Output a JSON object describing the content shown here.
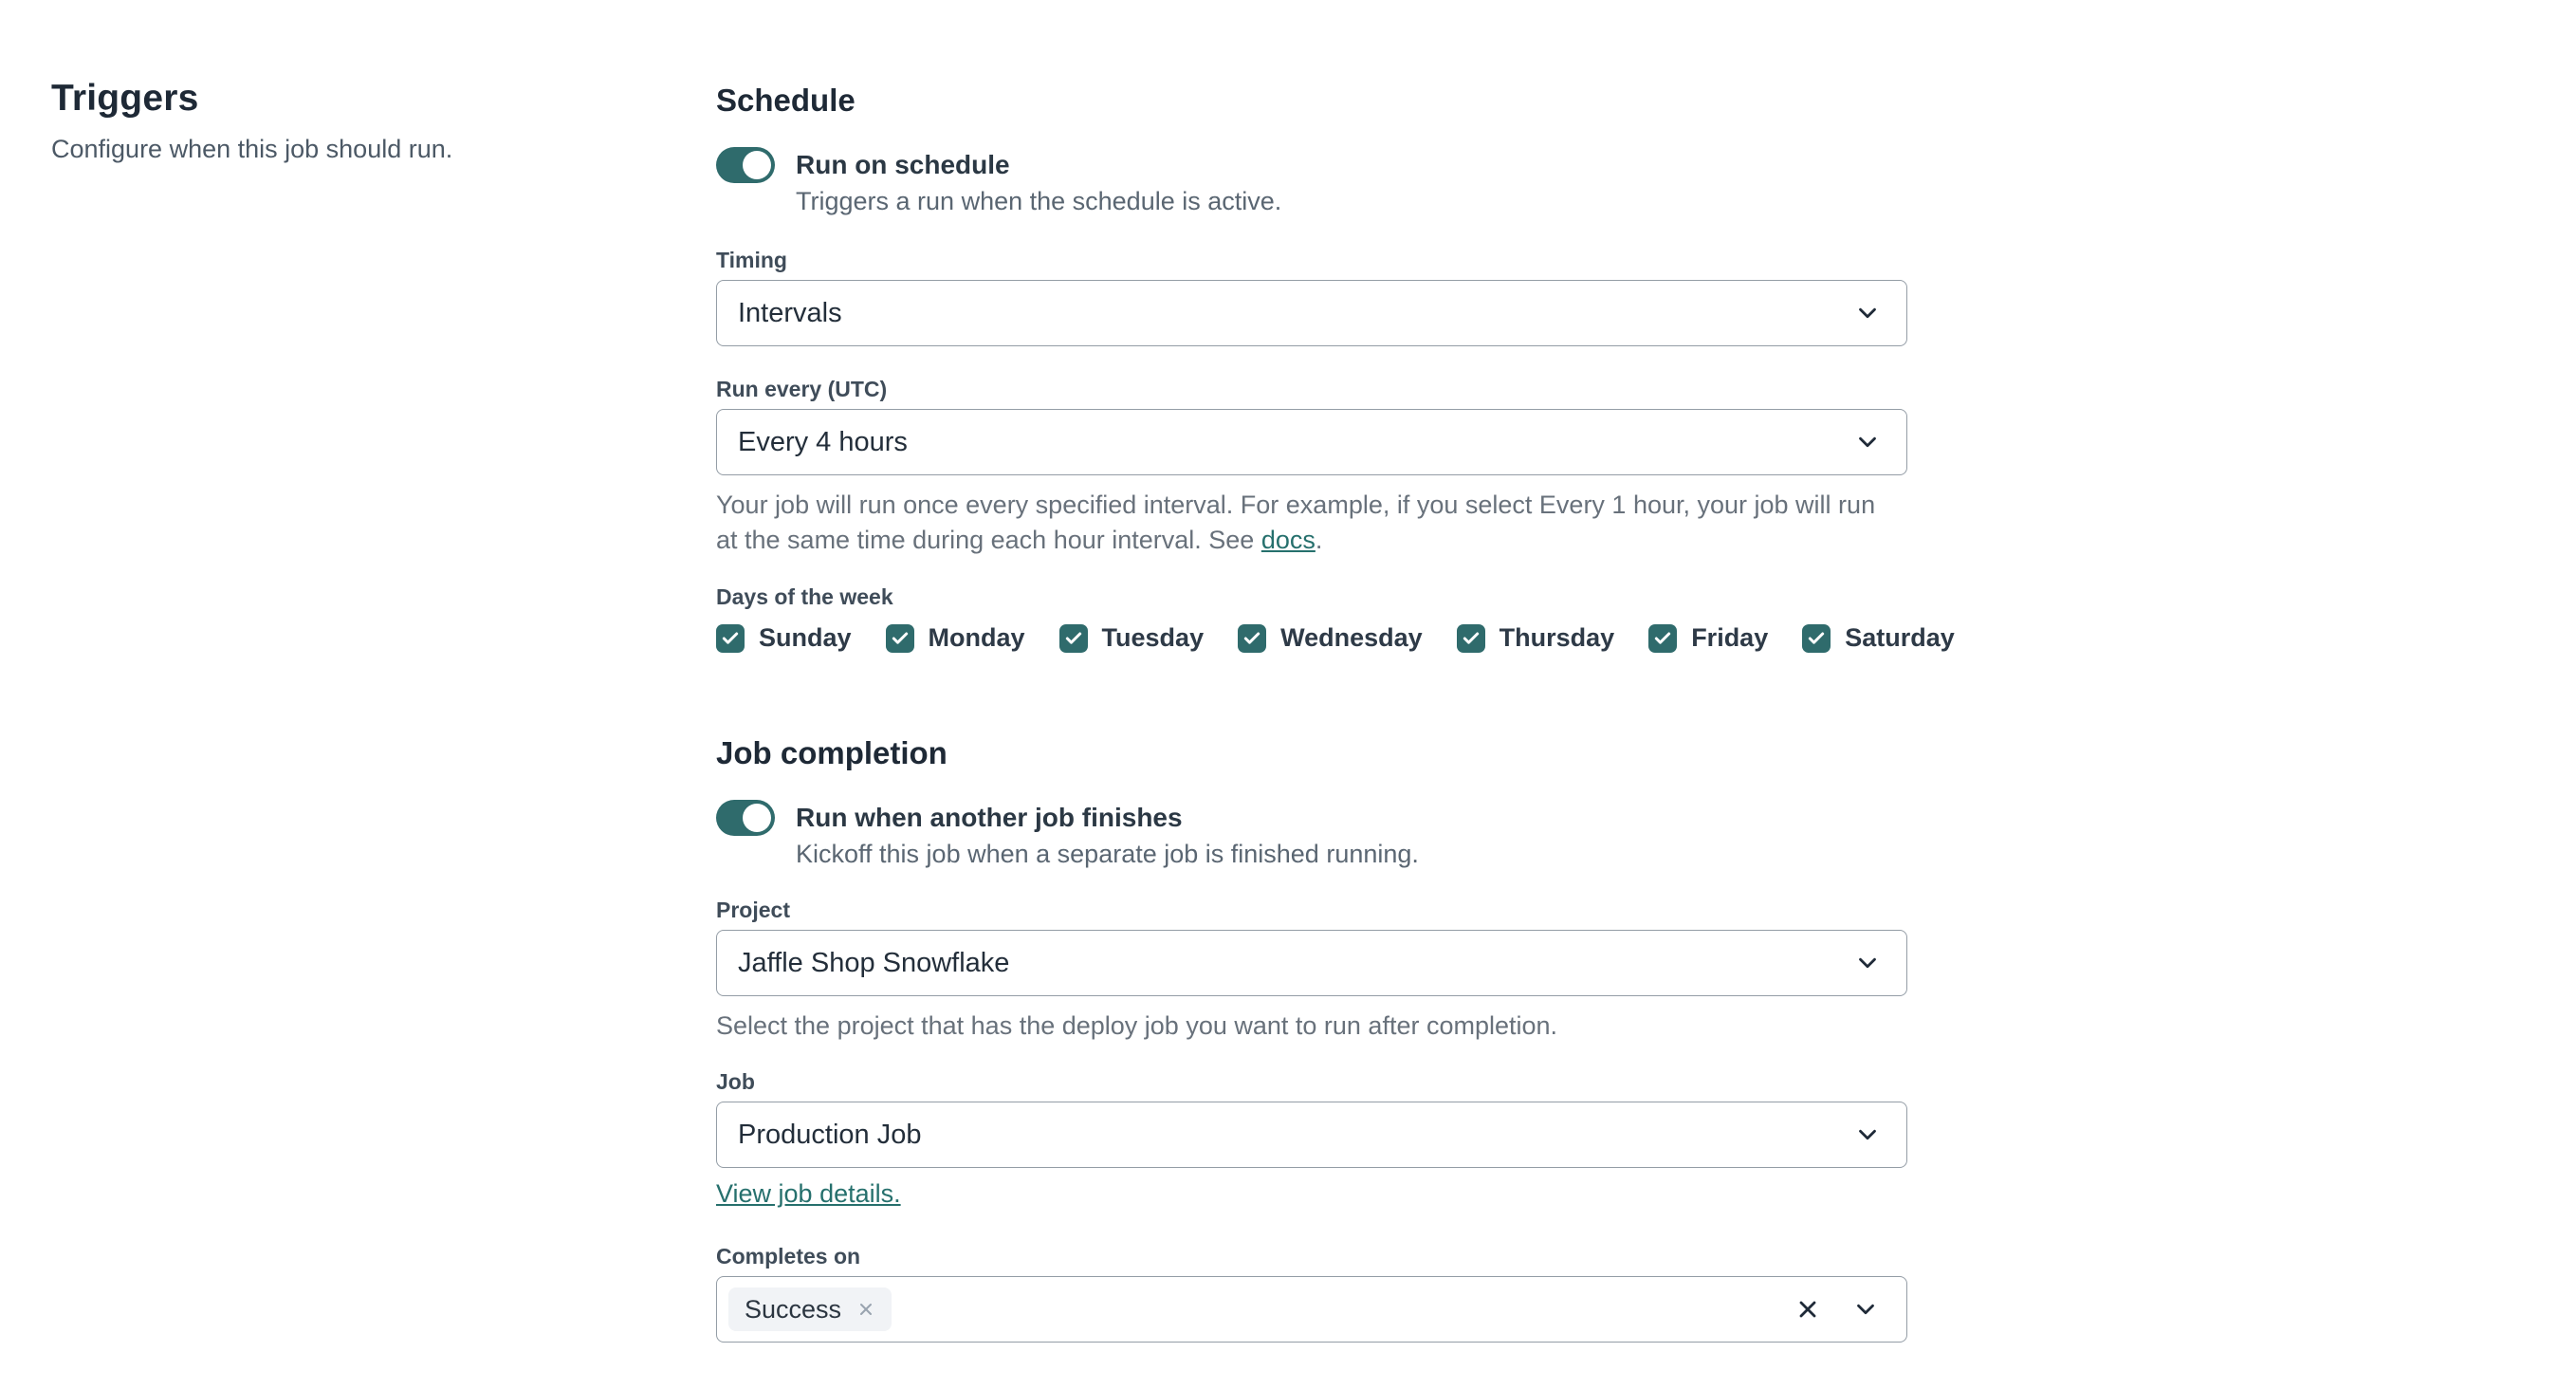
{
  "colors": {
    "accent_teal": "#2f6b6c",
    "link_teal": "#26706d",
    "border_gray": "#949da6",
    "heading_dark": "#1e2936",
    "chip_bg": "#f1f3f6"
  },
  "left": {
    "title": "Triggers",
    "subtitle": "Configure when this job should run."
  },
  "schedule": {
    "heading": "Schedule",
    "toggle": {
      "label": "Run on schedule",
      "description": "Triggers a run when the schedule is active.",
      "state": "on"
    },
    "timing": {
      "label": "Timing",
      "value": "Intervals"
    },
    "run_every": {
      "label": "Run every (UTC)",
      "value": "Every 4 hours",
      "help_before": "Your job will run once every specified interval. For example, if you select Every 1 hour, your job will run at the same time during each hour interval. See ",
      "help_link": "docs",
      "help_after": "."
    },
    "days": {
      "label": "Days of the week",
      "items": [
        {
          "label": "Sunday",
          "checked": true
        },
        {
          "label": "Monday",
          "checked": true
        },
        {
          "label": "Tuesday",
          "checked": true
        },
        {
          "label": "Wednesday",
          "checked": true
        },
        {
          "label": "Thursday",
          "checked": true
        },
        {
          "label": "Friday",
          "checked": true
        },
        {
          "label": "Saturday",
          "checked": true
        }
      ]
    }
  },
  "job_completion": {
    "heading": "Job completion",
    "toggle": {
      "label": "Run when another job finishes",
      "description": "Kickoff this job when a separate job is finished running.",
      "state": "on"
    },
    "project": {
      "label": "Project",
      "value": "Jaffle Shop Snowflake",
      "help": "Select the project that has the deploy job you want to run after completion."
    },
    "job": {
      "label": "Job",
      "value": "Production Job",
      "link": "View job details."
    },
    "completes_on": {
      "label": "Completes on",
      "chips": [
        {
          "label": "Success"
        }
      ]
    }
  }
}
